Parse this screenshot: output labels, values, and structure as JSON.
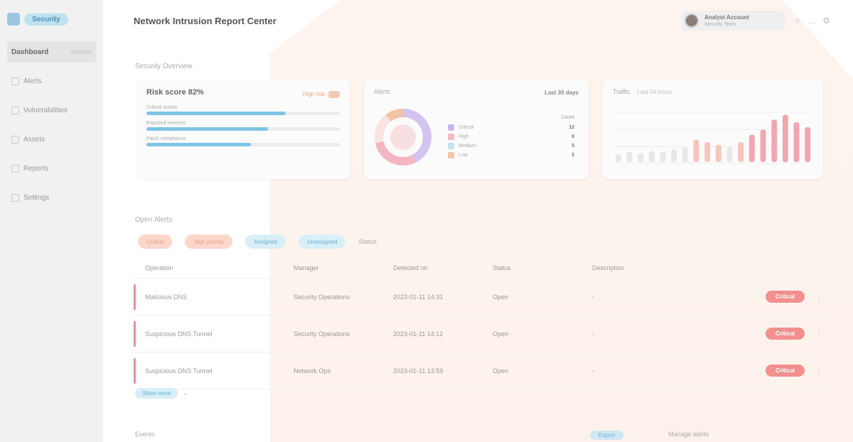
{
  "sidebar": {
    "logo_label": "Security",
    "items": [
      {
        "label": "Dashboard",
        "active": true
      },
      {
        "label": "Alerts"
      },
      {
        "label": "Vulnerabilities"
      },
      {
        "label": "Assets"
      },
      {
        "label": "Reports"
      },
      {
        "label": "Settings"
      }
    ]
  },
  "header": {
    "title": "Network Intrusion Report Center",
    "user_name": "Analyst Account",
    "user_role": "Security Team",
    "icons": [
      "bell-icon",
      "help-icon",
      "settings-icon"
    ]
  },
  "overview": {
    "section_label": "Security Overview",
    "card1": {
      "title": "Risk score 82%",
      "warn_label": "High risk",
      "bars": [
        {
          "label": "Critical assets",
          "value": 0.72
        },
        {
          "label": "Exposed services",
          "value": 0.63
        },
        {
          "label": "Patch compliance",
          "value": 0.54
        }
      ]
    },
    "card2": {
      "title": "Alerts",
      "filter": "Last 30 days",
      "legend_head": "Count",
      "legend": [
        {
          "label": "Critical",
          "value": "12",
          "color": "#c9b8ec"
        },
        {
          "label": "High",
          "value": "8",
          "color": "#f6b8c6"
        },
        {
          "label": "Medium",
          "value": "5",
          "color": "#c7e3f2"
        },
        {
          "label": "Low",
          "value": "3",
          "color": "#f6c4a8"
        }
      ],
      "donut_colors": [
        "#d4c2f1",
        "#f4b6c3",
        "#fbe2e4",
        "#f3c3a6"
      ]
    },
    "card3": {
      "title": "Traffic",
      "subtitle": "Last 24 hours"
    }
  },
  "filters": {
    "section_label": "Open Alerts",
    "chips": [
      {
        "label": "Critical",
        "bg": "#fbd7cb",
        "fg": "#e79c83"
      },
      {
        "label": "High priority",
        "bg": "#fbd7cb",
        "fg": "#e79c83"
      },
      {
        "label": "Assigned",
        "bg": "#d9eff7",
        "fg": "#6ab0cf"
      },
      {
        "label": "Unassigned",
        "bg": "#d9eff7",
        "fg": "#6ab0cf"
      }
    ],
    "plain_label": "Status"
  },
  "table": {
    "headers": [
      "Operation",
      "Manager",
      "Detected on",
      "Status",
      "Description"
    ],
    "rows": [
      {
        "operation": "Malicious DNS",
        "manager": "Security Operations",
        "date": "2023-01-11 14:31",
        "status": "Open",
        "desc": "-",
        "severity": "Critical"
      },
      {
        "operation": "Suspicious DNS Tunnel",
        "manager": "Security Operations",
        "date": "2023-01-11 14:12",
        "status": "Open",
        "desc": "-",
        "severity": "Critical"
      },
      {
        "operation": "Suspicious DNS Tunnel",
        "manager": "Network Ops",
        "date": "2023-01-11 13:59",
        "status": "Open",
        "desc": "-",
        "severity": "Critical"
      }
    ]
  },
  "show_more_label": "Show more",
  "footer": {
    "left_label": "Events",
    "button_label": "Export",
    "right_label": "Manage alerts"
  }
}
